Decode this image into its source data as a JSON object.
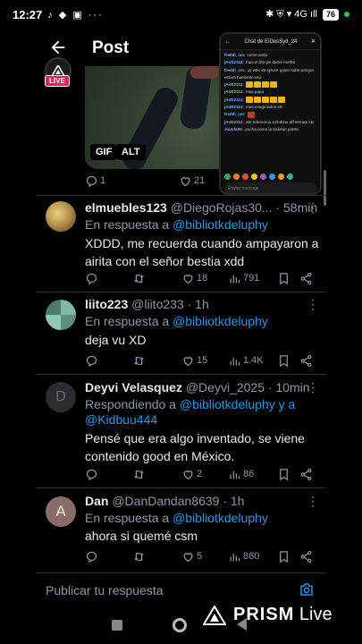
{
  "status_bar": {
    "time": "12:27",
    "left_icons": "♪ ◆ ▣ ···",
    "right_icons": "✱ ⛨ ▾ 4G ıll",
    "battery": "76"
  },
  "header": {
    "title": "Post",
    "live_badge": "LIVE"
  },
  "media": {
    "gif_label": "GIF",
    "alt_label": "ALT"
  },
  "overlay_chat": {
    "title": "Chat de ElDosSyd_24",
    "messages": [
      {
        "user": "",
        "text": ""
      },
      {
        "user": "freddi_cm:",
        "text": "como anita"
      },
      {
        "user": "jAsD2112:",
        "text": "mas el link pe dame morbo"
      },
      {
        "user": "freddi_cm:",
        "text": "uy wbn xa sylvee quien sabe porque estará haciendo eso"
      },
      {
        "user": "jAsD2112:",
        "text": ""
      },
      {
        "user": "jAsD2112:",
        "text": "mas papu"
      },
      {
        "user": "jAsD2112:",
        "text": ""
      },
      {
        "user": "jAsD2112:",
        "text": "mas exagerados xD"
      },
      {
        "user": "freddi_cm:",
        "text": ""
      },
      {
        "user": "jAsD2112:",
        "text": "XD referencia a Roblox off stream xD"
      },
      {
        "user": "Juvol290:",
        "text": "pucha como la trakean pobre"
      }
    ],
    "input_placeholder": "Enviar mensaje"
  },
  "first_tweet_actions": {
    "replies": "1",
    "likes": "21"
  },
  "tweets": [
    {
      "name": "elmuebles123",
      "handle": "@DiegoRojas30...",
      "time": "· 58min",
      "reply_prefix": "En respuesta a",
      "reply_to": "@bibliotkdeluphy",
      "text": "XDDD, me recuerda cuando ampayaron a airita con el señor bestia xdd",
      "likes": "18",
      "views": "791"
    },
    {
      "name": "liito223",
      "handle": "@liito233",
      "time": "· 1h",
      "reply_prefix": "En respuesta a",
      "reply_to": "@bibliotkdeluphy",
      "text": "deja vu XD",
      "likes": "15",
      "views": "1.4K"
    },
    {
      "name": "Deyvi Velasquez",
      "handle": "@Deyvi_2025",
      "time": "· 10min",
      "reply_prefix": "Respondiendo a",
      "reply_to": "@bibliotkdeluphy y a",
      "reply_to2": "@Kidbuu444",
      "text": "Pensé que era algo inventado, se viene contenido good en México.",
      "likes": "2",
      "views": "86"
    },
    {
      "name": "Dan",
      "handle": "@DanDandan8639",
      "time": "· 1h",
      "reply_prefix": "En respuesta a",
      "reply_to": "@bibliotkdeluphy",
      "text": "ahora si quemé csm",
      "likes": "5",
      "views": "860"
    }
  ],
  "reply_bar": {
    "placeholder": "Publicar tu respuesta"
  },
  "watermark": {
    "brand": "PRISM",
    "suffix": "Live"
  },
  "colors": {
    "background": "#000000",
    "accent": "#1d9bf0",
    "muted": "#8b98a5",
    "live": "#e0245e"
  }
}
